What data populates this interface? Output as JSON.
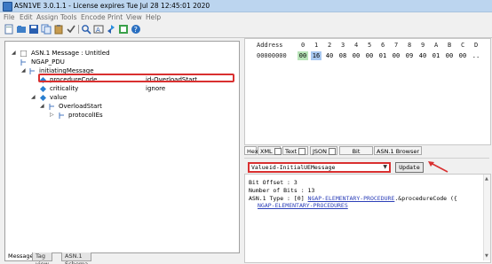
{
  "window": {
    "title": "ASN1VE 3.0.1.1 - License expires Tue Jul 28 12:45:01 2020"
  },
  "menu": [
    "File",
    "Edit",
    "Assign",
    "Tools",
    "Encode",
    "Print",
    "View",
    "Help"
  ],
  "toolbar": {
    "icons": [
      "new-file-icon",
      "open-file-icon",
      "save-icon",
      "copy-icon",
      "paste-icon",
      "check-icon",
      "search-icon",
      "find-next-icon",
      "refresh-icon",
      "export-icon",
      "help-icon"
    ]
  },
  "tree": {
    "root": "ASN.1 Message : Untitled",
    "pdu": "NGAP_PDU",
    "initiating": "initiatingMessage",
    "procedureCode": {
      "label": "procedureCode",
      "value": "id-OverloadStart"
    },
    "criticality": {
      "label": "criticality",
      "value": "ignore"
    },
    "value": "value",
    "overloadStart": "OverloadStart",
    "protocolIEs": "protocolIEs"
  },
  "left_tabs": [
    "Message",
    "Tag view",
    "ASN.1 Schema"
  ],
  "hex": {
    "address_label": "Address",
    "columns": [
      "0",
      "1",
      "2",
      "3",
      "4",
      "5",
      "6",
      "7",
      "8",
      "9",
      "A",
      "B",
      "C",
      "D"
    ],
    "row_address": "00000000",
    "row_bytes": [
      "00",
      "16",
      "40",
      "08",
      "00",
      "00",
      "01",
      "00",
      "09",
      "40",
      "01",
      "00",
      "00",
      ".."
    ]
  },
  "right_tabs": {
    "hex": "Hex",
    "xml": "XML",
    "text": "Text",
    "json": "JSON",
    "bit": "Bit",
    "browser": "ASN.1 Browser"
  },
  "value_bar": {
    "label": "Value:",
    "selected": "id-InitialUEMessage",
    "update": "Update"
  },
  "details": {
    "bit_offset": "Bit Offset : 3",
    "num_bits": "Number of Bits : 13",
    "asn_type_prefix": "ASN.1 Type : [0] ",
    "asn_type_link": "NGAP-ELEMENTARY-PROCEDURE",
    "asn_type_suffix": ".&procedureCode ({",
    "asn_type_link2": "NGAP-ELEMENTARY-PROCEDURES"
  },
  "colors": {
    "highlight_border": "#d93030",
    "hex_sel_1": "#b8e4b8",
    "hex_sel_2": "#a8c8f0",
    "link": "#2c3fb8"
  }
}
